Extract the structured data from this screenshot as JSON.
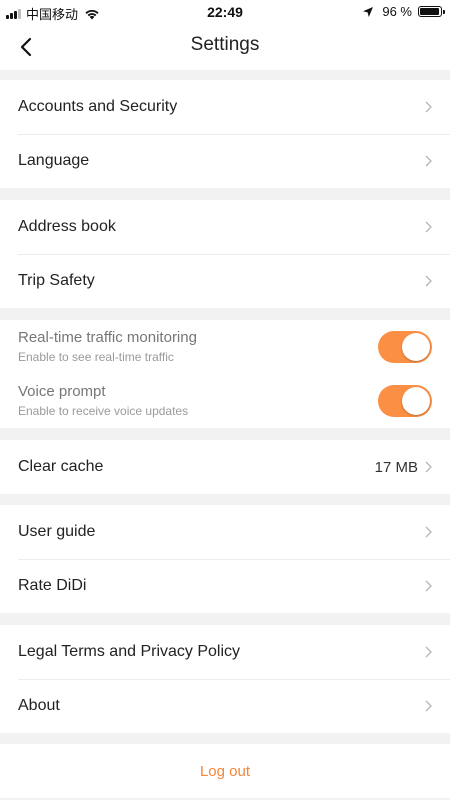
{
  "status_bar": {
    "carrier": "中国移动",
    "time": "22:49",
    "battery_percent": "96 %",
    "battery_level": 0.96
  },
  "header": {
    "title": "Settings",
    "back_icon": "chevron-left-icon"
  },
  "groups": {
    "account": [
      {
        "label": "Accounts and Security"
      },
      {
        "label": "Language"
      }
    ],
    "contacts": [
      {
        "label": "Address book"
      },
      {
        "label": "Trip Safety"
      }
    ],
    "toggles": [
      {
        "title": "Real-time traffic monitoring",
        "subtitle": "Enable to see real-time traffic",
        "on": true
      },
      {
        "title": "Voice prompt",
        "subtitle": "Enable to receive voice updates",
        "on": true
      }
    ],
    "cache": {
      "label": "Clear cache",
      "value": "17 MB"
    },
    "help": [
      {
        "label": "User guide"
      },
      {
        "label": "Rate DiDi"
      }
    ],
    "legal": [
      {
        "label": "Legal Terms and Privacy Policy"
      },
      {
        "label": "About"
      }
    ]
  },
  "logout_label": "Log out",
  "colors": {
    "accent": "#fb8a3a",
    "logout_text": "#f5863a",
    "background": "#f2f2f2"
  }
}
